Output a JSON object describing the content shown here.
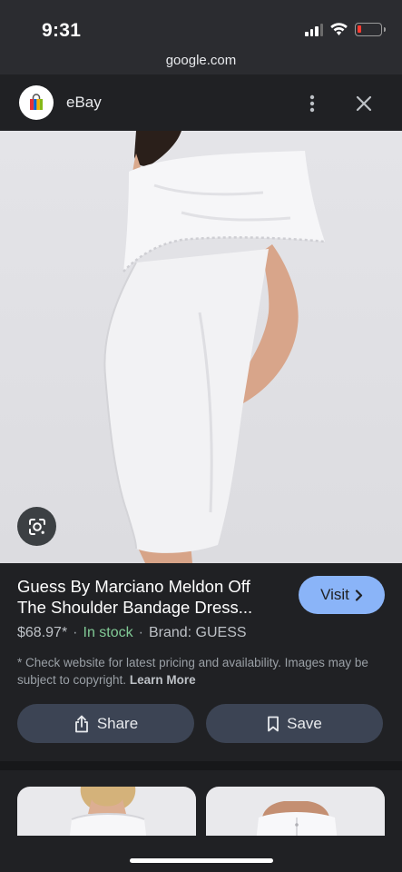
{
  "status_bar": {
    "time": "9:31",
    "icons": [
      "cellular-signal-icon",
      "wifi-icon",
      "battery-low-icon"
    ]
  },
  "browser": {
    "url": "google.com"
  },
  "site_header": {
    "site_name": "eBay",
    "logo_icon": "ebay-shopping-bag-icon",
    "menu_icon": "more-vertical-icon",
    "close_icon": "close-icon"
  },
  "hero": {
    "description_icon": "google-lens-icon"
  },
  "product": {
    "title_line1": "Guess By Marciano Meldon Off",
    "title_line2": "The Shoulder Bandage Dress...",
    "price": "$68.97*",
    "separator": "·",
    "stock": "In stock",
    "brand": "Brand: GUESS",
    "disclaimer": "* Check website for latest pricing and availability. Images may be subject to copyright.",
    "learn_more": "Learn More",
    "visit_label": "Visit",
    "share_label": "Share",
    "save_label": "Save"
  },
  "colors": {
    "accent": "#8ab4f8",
    "stock": "#81c995",
    "background": "#202124",
    "button": "#3c4454"
  }
}
